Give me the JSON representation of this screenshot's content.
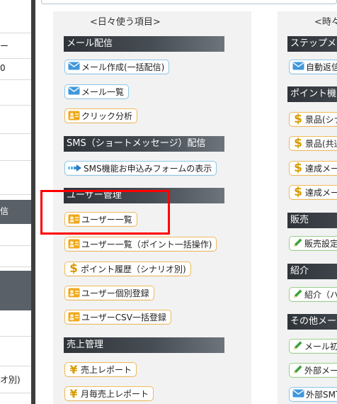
{
  "sidebar": {
    "items": [
      {
        "label": ""
      },
      {
        "label": "ー"
      },
      {
        "label": "0"
      },
      {
        "label": ""
      },
      {
        "label": ""
      },
      {
        "label": "信"
      },
      {
        "label": ""
      },
      {
        "label": ""
      },
      {
        "label": ""
      },
      {
        "label": "オ別)"
      }
    ]
  },
  "daily": {
    "title": "<日々使う項目>",
    "mail_header": "メール配信",
    "mail_create": "メール作成(一括配信)",
    "mail_list": "メール一覧",
    "click_analysis": "クリック分析",
    "sms_header": "SMS（ショートメッセージ）配信",
    "sms_form": "SMS機能お申込みフォームの表示",
    "user_header": "ユーザー管理",
    "user_list": "ユーザー一覧",
    "user_list_points": "ユーザー一覧（ポイント一括操作)",
    "point_history": "ポイント履歴（シナリオ別)",
    "user_register": "ユーザー個別登録",
    "user_csv": "ユーザーCSV一括登録",
    "sales_header": "売上管理",
    "sales_report": "売上レポート",
    "monthly_sales": "月毎売上レポート"
  },
  "occasional": {
    "title": "<時々",
    "step_header": "ステップメ",
    "auto_reply": "自動返信",
    "point_header": "ポイント機",
    "prize_scenario": "景品(シナ",
    "prize_shared": "景品(共通",
    "achievement_1": "達成メー",
    "achievement_2": "達成メー",
    "sales_header": "販売",
    "sales_settings": "販売設定",
    "intro_header": "紹介",
    "intro_item": "紹介（ハ",
    "other_header": "その他メー",
    "mail_init": "メール初",
    "external_mail": "外部メー",
    "external_smtp": "外部SMT"
  }
}
